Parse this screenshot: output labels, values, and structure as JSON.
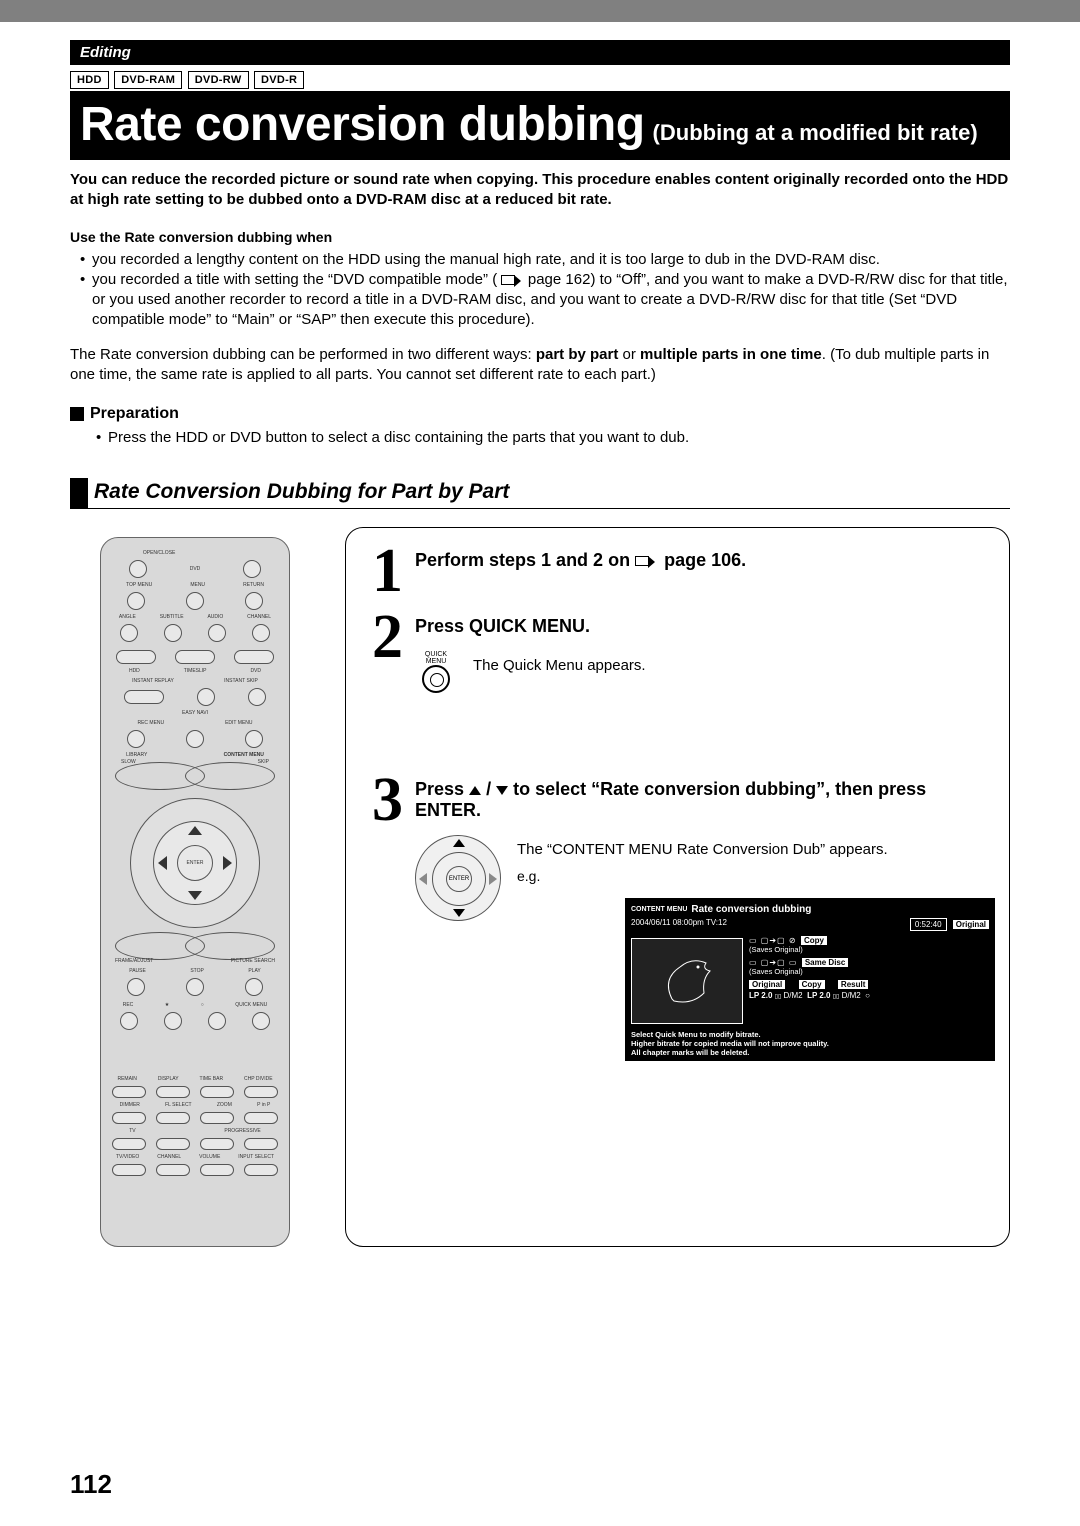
{
  "header": {
    "section": "Editing",
    "media": [
      "HDD",
      "DVD-RAM",
      "DVD-RW",
      "DVD-R"
    ],
    "title_main": "Rate conversion dubbing",
    "title_sub": "(Dubbing at a modified bit rate)"
  },
  "intro": "You can reduce the recorded picture or sound rate when copying. This procedure enables content originally recorded onto the HDD at high rate setting to be dubbed onto a DVD-RAM disc at a reduced bit rate.",
  "use_when": {
    "heading": "Use the Rate conversion dubbing when",
    "b1": "you recorded a lengthy content on the HDD using the manual high rate, and it is too large to dub in the DVD-RAM disc.",
    "b2_a": "you recorded a title with setting the “DVD compatible mode” (",
    "b2_b": " page 162) to “Off”, and you want to make a DVD-R/RW disc for that title, or you used another recorder to record a title in a DVD-RAM disc, and you want to create a DVD-R/RW disc for that title (Set “DVD compatible mode” to “Main” or “SAP” then execute this procedure)."
  },
  "note": {
    "a": "The Rate conversion dubbing can be performed in two different ways: ",
    "b": "part by part",
    "c": " or ",
    "d": "multiple parts in one time",
    "e": ". (To dub multiple parts in one time, the same rate is applied to all parts. You cannot set different rate to each part.)"
  },
  "prep": {
    "heading": "Preparation",
    "b1": "Press the HDD or DVD button to select a disc containing the parts that you want to dub."
  },
  "subsection": "Rate Conversion Dubbing for Part by Part",
  "steps": {
    "s1_a": "Perform steps 1 and 2 on ",
    "s1_b": " page 106.",
    "s2": "Press QUICK MENU.",
    "s2_desc": "The Quick Menu appears.",
    "s2_icon_label": "QUICK MENU",
    "s3_a": "Press ",
    "s3_b": " / ",
    "s3_c": " to select “Rate conversion dubbing”, then press ENTER.",
    "s3_desc": "The “CONTENT MENU Rate Conversion Dub” appears.",
    "s3_eg": "e.g.",
    "s3_enter": "ENTER"
  },
  "remote": {
    "open_close": "OPEN/CLOSE",
    "dvd": "DVD",
    "top_menu": "TOP MENU",
    "menu": "MENU",
    "return": "RETURN",
    "angle": "ANGLE",
    "subtitle": "SUBTITLE",
    "audio": "AUDIO",
    "channel": "CHANNEL",
    "hdd": "HDD",
    "timeslip": "TIMESLIP",
    "dvd2": "DVD",
    "easy_navi": "EASY NAVI",
    "instant_replay": "INSTANT REPLAY",
    "instant_skip": "INSTANT SKIP",
    "rec_menu": "REC MENU",
    "edit_menu": "EDIT MENU",
    "library": "LIBRARY",
    "content_menu": "CONTENT MENU",
    "slow": "SLOW",
    "skip": "SKIP",
    "enter": "ENTER",
    "frame_adjust": "FRAME/ADJUST",
    "picture_search": "PICTURE SEARCH",
    "pause": "PAUSE",
    "stop": "STOP",
    "play": "PLAY",
    "rec": "REC",
    "star": "★",
    "circle_btn": "○",
    "quick_menu": "QUICK MENU",
    "remain": "REMAIN",
    "display": "DISPLAY",
    "time_bar": "TIME BAR",
    "chp_divide": "CHP DIVIDE",
    "dimmer": "DIMMER",
    "fl_select": "FL SELECT",
    "zoom": "ZOOM",
    "pinp": "P in P",
    "tv": "TV",
    "progressive": "PROGRESSIVE",
    "tv_video": "TV/VIDEO",
    "channel2": "CHANNEL",
    "volume": "VOLUME",
    "input_select": "INPUT SELECT"
  },
  "osd": {
    "menu_label": "CONTENT MENU",
    "title": "Rate conversion dubbing",
    "date": "2004/06/11  08:00pm  TV:12",
    "time": "0:52:40",
    "original": "Original",
    "copy": "Copy",
    "saves": "(Saves Original)",
    "same_disc": "Same Disc",
    "result": "Result",
    "lp": "LP 2.0",
    "dm2": "D/M2",
    "footer1": "Select Quick Menu to modify bitrate.",
    "footer2": "Higher bitrate for copied media will not improve quality.",
    "footer3": "All chapter marks will be deleted."
  },
  "page_number": "112"
}
